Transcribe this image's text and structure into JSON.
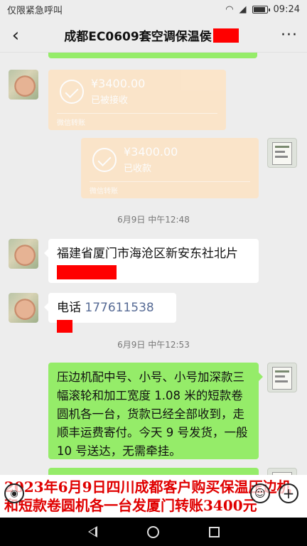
{
  "status_bar": {
    "carrier": "仅限紧急呼叫",
    "time": "09:24",
    "wifi_icon": "wifi-icon",
    "signal_icon": "signal-icon"
  },
  "header": {
    "title": "成都EC0609套空调保温侯",
    "back_icon": "chevron-left-icon",
    "more_icon": "more-dots-icon"
  },
  "messages": {
    "transfer_received": {
      "amount": "¥3400.00",
      "status": "已被接收",
      "footer": "微信转账"
    },
    "transfer_sent": {
      "amount": "¥3400.00",
      "status": "已收款",
      "footer": "微信转账"
    },
    "time_1": "6月9日 中午12:48",
    "address": {
      "line1": "福建省厦门市海沧区新安东社北片"
    },
    "phone": {
      "label": "电话",
      "number": "177611538"
    },
    "time_2": "6月9日 中午12:53",
    "order_note": "压边机配中号、小号、小号加深款三幅滚轮和加工宽度 1.08 米的短款卷圆机各一台，货款已经全部收到，走顺丰运费寄付。今天 9 号发货，一般 10 号送达，无需牵挂。"
  },
  "caption": "2023年6月9日四川成都客户购买保温压边机和短款卷圆机各一台发厦门转账3400元",
  "input_bar": {
    "voice_icon": "voice-icon",
    "emoji_icon": "emoji-icon",
    "plus_icon": "plus-icon"
  },
  "nav": {
    "back_icon": "nav-back-icon",
    "home_icon": "nav-home-icon",
    "recent_icon": "nav-recent-icon"
  }
}
